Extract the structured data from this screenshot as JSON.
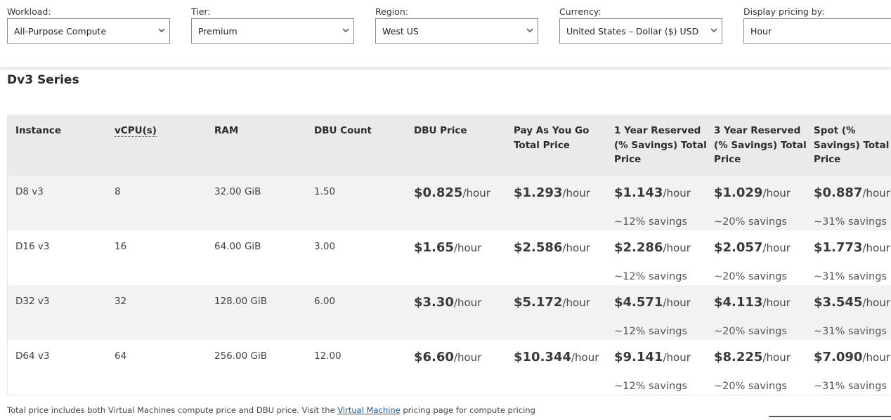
{
  "filters": [
    {
      "label": "Workload:",
      "value": "All-Purpose Compute"
    },
    {
      "label": "Tier:",
      "value": "Premium"
    },
    {
      "label": "Region:",
      "value": "West US"
    },
    {
      "label": "Currency:",
      "value": "United States – Dollar ($) USD"
    },
    {
      "label": "Display pricing by:",
      "value": "Hour"
    }
  ],
  "section": {
    "title": "Dv3 Series"
  },
  "table": {
    "headers": [
      "Instance",
      "vCPU(s)",
      "RAM",
      "DBU Count",
      "DBU Price",
      "Pay As You Go Total Price",
      "1 Year Reserved (% Savings) Total Price",
      "3 Year Reserved (% Savings) Total Price",
      "Spot (% Savings) Total Price"
    ],
    "unit": "/hour",
    "rows": [
      {
        "instance": "D8 v3",
        "vcpu": "8",
        "ram": "32.00 GiB",
        "dbu_count": "1.50",
        "dbu_price": "$0.825",
        "payg": "$1.293",
        "yr1": "$1.143",
        "yr1_savings": "~12% savings",
        "yr3": "$1.029",
        "yr3_savings": "~20% savings",
        "spot": "$0.887",
        "spot_savings": "~31% savings"
      },
      {
        "instance": "D16 v3",
        "vcpu": "16",
        "ram": "64.00 GiB",
        "dbu_count": "3.00",
        "dbu_price": "$1.65",
        "payg": "$2.586",
        "yr1": "$2.286",
        "yr1_savings": "~12% savings",
        "yr3": "$2.057",
        "yr3_savings": "~20% savings",
        "spot": "$1.773",
        "spot_savings": "~31% savings"
      },
      {
        "instance": "D32 v3",
        "vcpu": "32",
        "ram": "128.00 GiB",
        "dbu_count": "6.00",
        "dbu_price": "$3.30",
        "payg": "$5.172",
        "yr1": "$4.571",
        "yr1_savings": "~12% savings",
        "yr3": "$4.113",
        "yr3_savings": "~20% savings",
        "spot": "$3.545",
        "spot_savings": "~31% savings"
      },
      {
        "instance": "D64 v3",
        "vcpu": "64",
        "ram": "256.00 GiB",
        "dbu_count": "12.00",
        "dbu_price": "$6.60",
        "payg": "$10.344",
        "yr1": "$9.141",
        "yr1_savings": "~12% savings",
        "yr3": "$8.225",
        "yr3_savings": "~20% savings",
        "spot": "$7.090",
        "spot_savings": "~31% savings"
      }
    ]
  },
  "footnote": {
    "before": "Total price includes both Virtual Machines compute price and DBU price. Visit the ",
    "link": "Virtual Machine",
    "after": " pricing page for compute pricing"
  },
  "colors": {
    "header_bg": "#e9eaeb",
    "alt_row_bg": "#f2f2f2",
    "link": "#1a5aa0"
  },
  "icons": {
    "dropdown": "chevron-down-icon"
  }
}
